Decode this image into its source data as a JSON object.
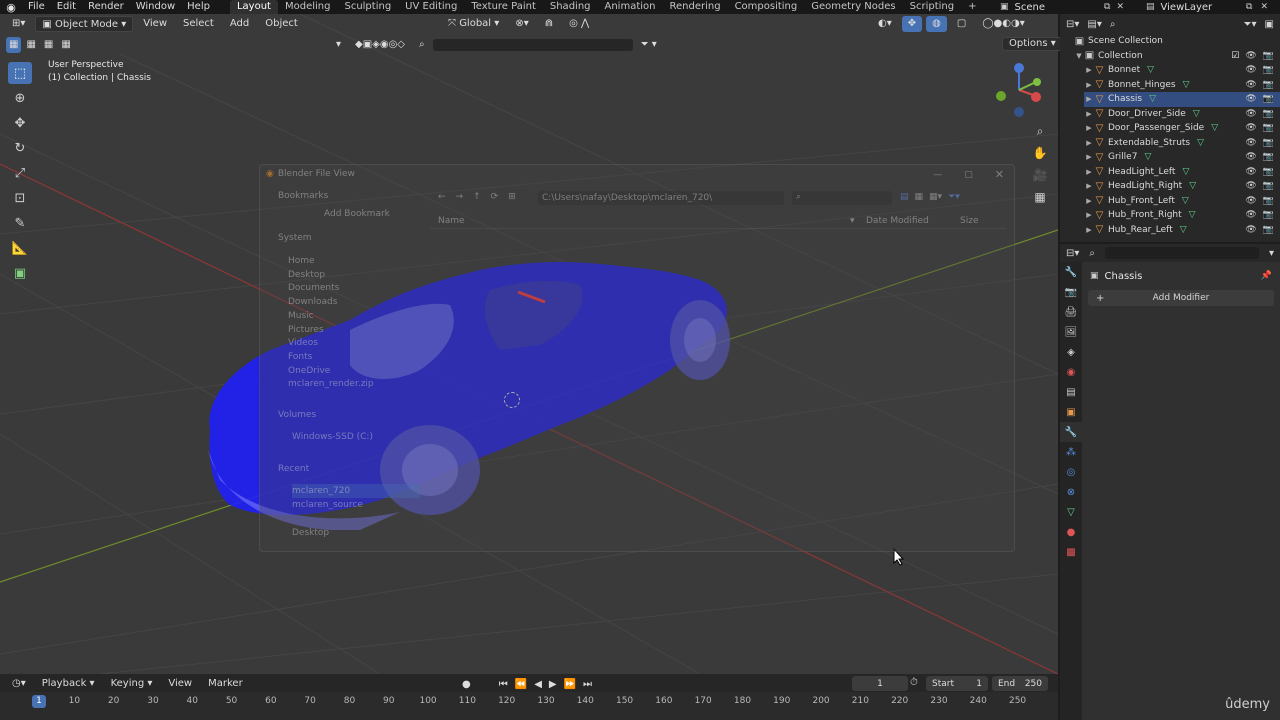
{
  "topbar": {
    "menus": [
      "File",
      "Edit",
      "Render",
      "Window",
      "Help"
    ],
    "workspaces": [
      "Layout",
      "Modeling",
      "Sculpting",
      "UV Editing",
      "Texture Paint",
      "Shading",
      "Animation",
      "Rendering",
      "Compositing",
      "Geometry Nodes",
      "Scripting"
    ],
    "active_workspace": "Layout",
    "add_tab": "+",
    "scene_label": "Scene",
    "viewlayer_label": "ViewLayer"
  },
  "viewport_header": {
    "mode": "Object Mode",
    "menus": [
      "View",
      "Select",
      "Add",
      "Object"
    ],
    "orientation": "Global",
    "options": "Options"
  },
  "viewport_info": {
    "perspective": "User Perspective",
    "collection": "(1) Collection | Chassis"
  },
  "file_dialog": {
    "title": "Blender File View",
    "bookmarks": "Bookmarks",
    "add_bookmark": "Add Bookmark",
    "system": "System",
    "system_items": [
      "Home",
      "Desktop",
      "Documents",
      "Downloads",
      "Music",
      "Pictures",
      "Videos",
      "Fonts",
      "OneDrive",
      "mclaren_render.zip"
    ],
    "volumes": "Volumes",
    "volume_items": [
      "Windows-SSD (C:)"
    ],
    "recent": "Recent",
    "recent_items": [
      "mclaren_720",
      "mclaren_source",
      "Desktop"
    ],
    "path": "C:\\Users\\nafay\\Desktop\\mclaren_720\\",
    "col_name": "Name",
    "col_date": "Date Modified",
    "col_size": "Size"
  },
  "outliner": {
    "root": "Scene Collection",
    "collection": "Collection",
    "items": [
      "Bonnet",
      "Bonnet_Hinges",
      "Chassis",
      "Door_Driver_Side",
      "Door_Passenger_Side",
      "Extendable_Struts",
      "Grille7",
      "HeadLight_Left",
      "HeadLight_Right",
      "Hub_Front_Left",
      "Hub_Front_Right",
      "Hub_Rear_Left"
    ],
    "selected": "Chassis"
  },
  "properties": {
    "object_name": "Chassis",
    "add_modifier": "Add Modifier",
    "add_plus": "+"
  },
  "timeline": {
    "menus": [
      "Playback",
      "Keying",
      "View",
      "Marker"
    ],
    "current_frame": "1",
    "start_label": "Start",
    "start_value": "1",
    "end_label": "End",
    "end_value": "250",
    "ticks": [
      "1",
      "10",
      "20",
      "30",
      "40",
      "50",
      "60",
      "70",
      "80",
      "90",
      "100",
      "110",
      "120",
      "130",
      "140",
      "150",
      "160",
      "170",
      "180",
      "190",
      "200",
      "210",
      "220",
      "230",
      "240",
      "250"
    ]
  },
  "watermark": "ûdemy",
  "colors": {
    "accent": "#4772b3",
    "selection": "#334d80",
    "car": "#1f1fff",
    "mesh_icon": "#5fd38a",
    "object_icon": "#e79a4a"
  }
}
